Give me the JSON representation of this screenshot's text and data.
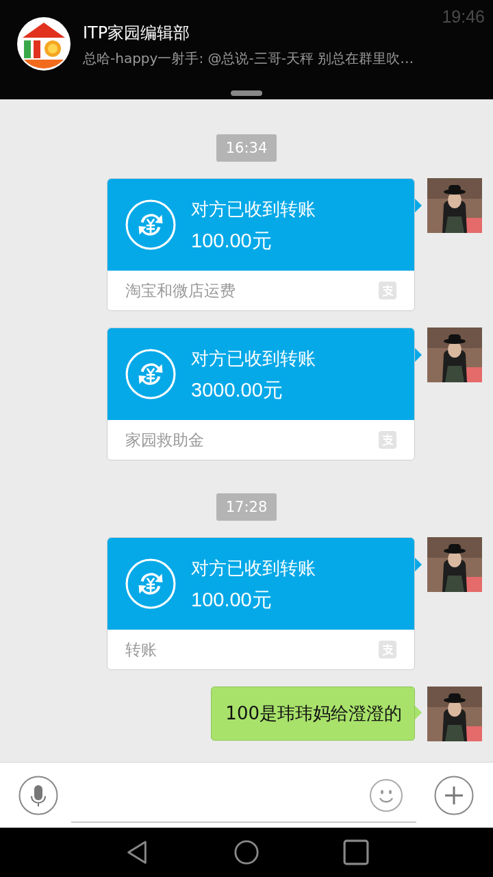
{
  "status_bar": {
    "time": "19:46"
  },
  "notification": {
    "title": "ITP家园编辑部",
    "message": "总哈-happy一射手: @总说-三哥-天秤 别总在群里吹…"
  },
  "messages": [
    {
      "kind": "time",
      "text": "16:34"
    },
    {
      "kind": "transfer",
      "status": "对方已收到转账",
      "amount": "100.00元",
      "note": "淘宝和微店运费"
    },
    {
      "kind": "transfer",
      "status": "对方已收到转账",
      "amount": "3000.00元",
      "note": "家园救助金"
    },
    {
      "kind": "time",
      "text": "17:28"
    },
    {
      "kind": "transfer",
      "status": "对方已收到转账",
      "amount": "100.00元",
      "note": "转账"
    },
    {
      "kind": "text",
      "text": "100是玮玮妈给澄澄的"
    }
  ]
}
